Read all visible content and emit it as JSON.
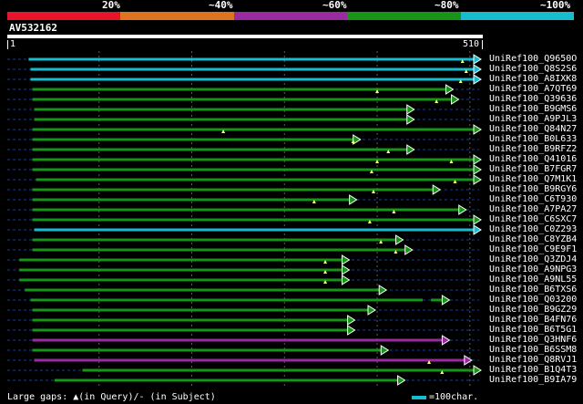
{
  "legend": {
    "colors": [
      "#e8152a",
      "#e0741c",
      "#9a2aa0",
      "#179517",
      "#17bccf"
    ],
    "labels": [
      "20%",
      "~40%",
      "~60%",
      "~80%",
      "~100%"
    ]
  },
  "query": {
    "name": "AV532162",
    "start": "1",
    "end": "510"
  },
  "hits": [
    {
      "name": "UniRef100_Q9650O",
      "start": 24,
      "end": 510,
      "color": "cyan",
      "gaps": [
        492
      ]
    },
    {
      "name": "UniRef100_Q8S2S6",
      "start": 26,
      "end": 510,
      "color": "cyan",
      "gaps": [
        496
      ]
    },
    {
      "name": "UniRef100_A8IXK8",
      "start": 26,
      "end": 510,
      "color": "cyan",
      "gaps": [
        490
      ]
    },
    {
      "name": "UniRef100_A7QT69",
      "start": 28,
      "end": 480,
      "color": "green",
      "gaps": [
        400
      ]
    },
    {
      "name": "UniRef100_Q39636",
      "start": 28,
      "end": 486,
      "color": "green",
      "gaps": [
        464
      ]
    },
    {
      "name": "UniRef100_B9GMS6",
      "start": 30,
      "end": 438,
      "color": "green",
      "gaps": []
    },
    {
      "name": "UniRef100_A9PJL3",
      "start": 30,
      "end": 438,
      "color": "green",
      "gaps": []
    },
    {
      "name": "UniRef100_Q84N27",
      "start": 28,
      "end": 510,
      "color": "green",
      "gaps": [
        234
      ]
    },
    {
      "name": "UniRef100_B0L633",
      "start": 28,
      "end": 380,
      "color": "green",
      "gaps": [
        374
      ]
    },
    {
      "name": "UniRef100_B9RFZ2",
      "start": 28,
      "end": 438,
      "color": "green",
      "gaps": [
        412
      ]
    },
    {
      "name": "UniRef100_Q41016",
      "start": 28,
      "end": 510,
      "color": "green",
      "gaps": [
        400,
        480
      ]
    },
    {
      "name": "UniRef100_B7FGR7",
      "start": 28,
      "end": 510,
      "color": "green",
      "gaps": [
        394
      ]
    },
    {
      "name": "UniRef100_Q7M1K1",
      "start": 32,
      "end": 510,
      "color": "green",
      "gaps": [
        484
      ]
    },
    {
      "name": "UniRef100_B9RGY6",
      "start": 28,
      "end": 466,
      "color": "green",
      "gaps": [
        396
      ]
    },
    {
      "name": "UniRef100_C6T930",
      "start": 28,
      "end": 376,
      "color": "green",
      "gaps": [
        332
      ]
    },
    {
      "name": "UniRef100_A7PA27",
      "start": 28,
      "end": 494,
      "color": "green",
      "gaps": [
        418
      ]
    },
    {
      "name": "UniRef100_C6SXC7",
      "start": 28,
      "end": 510,
      "color": "green",
      "gaps": [
        392
      ]
    },
    {
      "name": "UniRef100_C0Z293",
      "start": 30,
      "end": 510,
      "color": "cyan",
      "gaps": []
    },
    {
      "name": "UniRef100_C8YZB4",
      "start": 28,
      "end": 426,
      "color": "green",
      "gaps": [
        404
      ]
    },
    {
      "name": "UniRef100_C9E9F1",
      "start": 28,
      "end": 436,
      "color": "green",
      "gaps": [
        420
      ]
    },
    {
      "name": "UniRef100_Q3ZDJ4",
      "start": 14,
      "end": 368,
      "color": "green",
      "gaps": [
        344
      ]
    },
    {
      "name": "UniRef100_A9NPG3",
      "start": 14,
      "end": 368,
      "color": "green",
      "gaps": [
        344
      ]
    },
    {
      "name": "UniRef100_A9NL55",
      "start": 14,
      "end": 368,
      "color": "green",
      "gaps": [
        344
      ]
    },
    {
      "name": "UniRef100_B6TXS6",
      "start": 20,
      "end": 408,
      "color": "green",
      "gaps": []
    },
    {
      "name": "UniRef100_Q03200",
      "start": 26,
      "end": 476,
      "color": "green",
      "gaps": [],
      "segments": [
        [
          26,
          452
        ],
        [
          458,
          476
        ]
      ]
    },
    {
      "name": "UniRef100_B9GZ29",
      "start": 28,
      "end": 396,
      "color": "green",
      "gaps": []
    },
    {
      "name": "UniRef100_B4FN76",
      "start": 28,
      "end": 374,
      "color": "green",
      "gaps": []
    },
    {
      "name": "UniRef100_B6T5G1",
      "start": 28,
      "end": 374,
      "color": "green",
      "gaps": []
    },
    {
      "name": "UniRef100_Q3HNF6",
      "start": 28,
      "end": 476,
      "color": "purple",
      "gaps": []
    },
    {
      "name": "UniRef100_B6SSM8",
      "start": 28,
      "end": 410,
      "color": "green",
      "gaps": []
    },
    {
      "name": "UniRef100_Q8RVJ1",
      "start": 30,
      "end": 500,
      "color": "purple",
      "gaps": [
        456
      ]
    },
    {
      "name": "UniRef100_B1Q4T3",
      "start": 82,
      "end": 510,
      "color": "green",
      "gaps": [
        470
      ]
    },
    {
      "name": "UniRef100_B9IA79",
      "start": 52,
      "end": 428,
      "color": "green",
      "gaps": []
    }
  ],
  "footer": {
    "gaps_text": "Large gaps: ▲(in Query)/- (in Subject)",
    "scale_text": "=100char."
  }
}
